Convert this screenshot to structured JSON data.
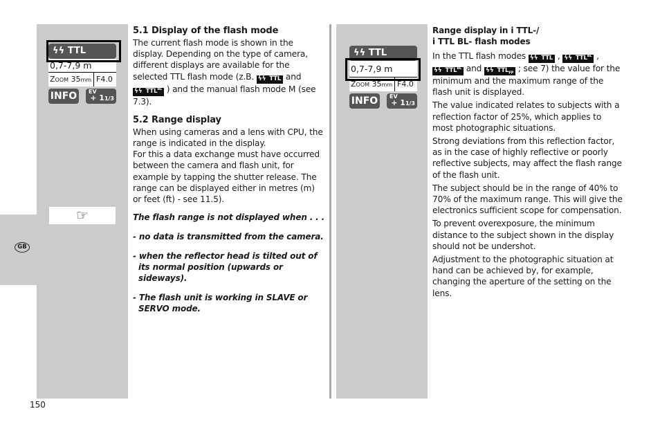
{
  "page_number": "150",
  "language_tab": "GB",
  "left_display": {
    "mode_icon": "flash-icon",
    "mode": "TTL",
    "range": "0,7-7,9 m",
    "zoom_label": "Zoom",
    "zoom_value": "35",
    "zoom_unit": "mm",
    "aperture": "F4.0",
    "info_button": "INFO",
    "ev_label": "EV",
    "ev_value": "+ 1",
    "ev_fraction": "1/3",
    "highlighted": "mode"
  },
  "right_display": {
    "mode_icon": "flash-icon",
    "mode": "TTL",
    "range": "0,7-7,9 m",
    "zoom_label": "Zoom",
    "zoom_value": "35",
    "zoom_unit": "mm",
    "aperture": "F4.0",
    "info_button": "INFO",
    "ev_label": "EV",
    "ev_value": "+ 1",
    "ev_fraction": "1/3",
    "highlighted": "range"
  },
  "note_icon": "pointing-hand-icon",
  "section_5_1": {
    "title": "5.1 Display of the flash mode",
    "body_before": "The current flash mode is shown in the display. Depending on the type of camera, different displays are available for the selected TTL flash mode (z.B. ",
    "badge1": "TTL",
    "and": " and ",
    "badge2": "TTL",
    "badge2_sup": "BL",
    "body_after": " ) and the manual flash mode M (see 7.3)."
  },
  "section_5_2": {
    "title": "5.2 Range display",
    "body1": "When using cameras and a lens with CPU, the range is indicated in the display.",
    "body2": "For this a data exchange must have occurred between the camera and flash unit, for example by tapping the shutter release. The range can be displayed either in metres (m) or feet (ft) - see 11.5)."
  },
  "note": {
    "heading": "The flash range is not displayed when . . .",
    "items": [
      "- no data is transmitted from the camera.",
      "- when the reflector head is tilted out of its normal position (upwards or sideways).",
      "- The flash unit is working in SLAVE or SERVO mode."
    ]
  },
  "right_column": {
    "title_line1": "Range display in i TTL-/",
    "title_line2": "i TTL BL- flash modes",
    "intro_before": "In the TTL flash modes ",
    "badges": [
      {
        "label": "TTL",
        "sup": "",
        "sub": ""
      },
      {
        "label": "TTL",
        "sup": "BL",
        "sub": ""
      },
      {
        "label": "TTL",
        "sup": "BL",
        "sub": "FP"
      },
      {
        "label": "TTL",
        "sup": "",
        "sub": "FP"
      }
    ],
    "intro_and": " and ",
    "intro_after": " ; see 7) the value for the minimum and the maximum range of the flash unit is displayed.",
    "paragraphs": [
      "The value indicated relates to subjects with a reflection factor of 25%, which applies to most photographic situations.",
      "Strong deviations from this reflection factor, as in the case of highly reflective or poorly reflective subjects, may affect the flash range of the flash unit.",
      "The subject should be in the range of 40% to 70% of the maximum range. This will give the electronics sufficient scope for compensation.",
      "To prevent overexposure, the minimum distance to the subject shown in the display should not be undershot.",
      "Adjustment to the photographic situation at hand can be achieved by, for example, changing the aperture of the setting on the lens."
    ]
  }
}
